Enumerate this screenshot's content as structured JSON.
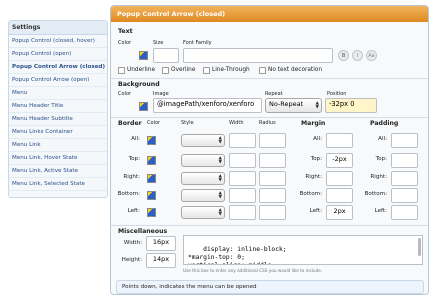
{
  "sidebar": {
    "header": "Settings",
    "items": [
      {
        "label": "Popup Control (closed, hover)"
      },
      {
        "label": "Popup Control (open)"
      },
      {
        "label": "Popup Control Arrow (closed)",
        "active": true
      },
      {
        "label": "Popup Control Arrow (open)"
      },
      {
        "label": "Menu"
      },
      {
        "label": "Menu Header Title"
      },
      {
        "label": "Menu Header Subtitle"
      },
      {
        "label": "Menu Links Container"
      },
      {
        "label": "Menu Link"
      },
      {
        "label": "Menu Link, Hover State"
      },
      {
        "label": "Menu Link, Active State"
      },
      {
        "label": "Menu Link, Selected State"
      }
    ]
  },
  "panel": {
    "title": "Popup Control Arrow (closed)",
    "text": {
      "title": "Text",
      "color_label": "Color",
      "size_label": "Size",
      "font_family_label": "Font Family",
      "size_value": "",
      "font_family_value": "",
      "bold": "B",
      "italic": "I",
      "case": "Aa",
      "underline": "Underline",
      "overline": "Overline",
      "line_through": "Line-Through",
      "no_decoration": "No text decoration"
    },
    "background": {
      "title": "Background",
      "color_label": "Color",
      "image_label": "Image",
      "repeat_label": "Repeat",
      "position_label": "Position",
      "image_value": "@imagePath/xenforo/xenforo",
      "repeat_value": "No-Repeat",
      "position_value": "-32px 0"
    },
    "border": {
      "title": "Border",
      "color_label": "Color",
      "style_label": "Style",
      "width_label": "Width",
      "radius_label": "Radius",
      "rows": [
        "All:",
        "Top:",
        "Right:",
        "Bottom:",
        "Left:"
      ]
    },
    "margin": {
      "title": "Margin",
      "rows": [
        {
          "label": "All:",
          "value": ""
        },
        {
          "label": "Top:",
          "value": "-2px"
        },
        {
          "label": "Right:",
          "value": ""
        },
        {
          "label": "Bottom:",
          "value": ""
        },
        {
          "label": "Left:",
          "value": "2px"
        }
      ]
    },
    "padding": {
      "title": "Padding",
      "rows": [
        {
          "label": "All:",
          "value": ""
        },
        {
          "label": "Top:",
          "value": ""
        },
        {
          "label": "Right:",
          "value": ""
        },
        {
          "label": "Bottom:",
          "value": ""
        },
        {
          "label": "Left:",
          "value": ""
        }
      ]
    },
    "misc": {
      "title": "Miscellaneous",
      "width_label": "Width:",
      "width_value": "16px",
      "height_label": "Height:",
      "height_value": "14px",
      "css_value": "display: inline-block;\n*margin-top: 0;\nvertical-align: middle;",
      "hint": "Use this box to enter any additional CSS you would like to include."
    },
    "description": "Points down, indicates the menu can be opened"
  },
  "icons": {
    "color_swatch": "color-picker-swatch-icon",
    "select_arrows": "up-down-arrows-icon"
  },
  "colors": {
    "header_orange": "#e09030",
    "link_blue": "#2a4f8a",
    "position_highlight": "#fff5c8"
  }
}
